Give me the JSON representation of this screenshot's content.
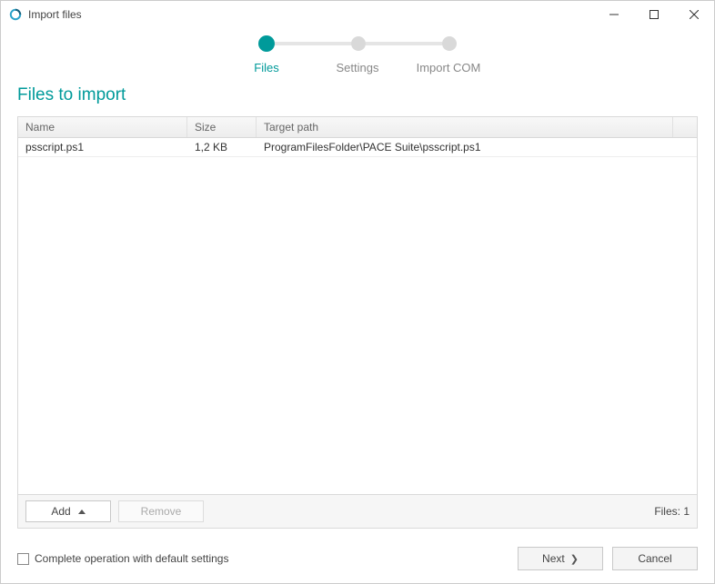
{
  "window": {
    "title": "Import files"
  },
  "stepper": {
    "steps": [
      {
        "label": "Files",
        "active": true
      },
      {
        "label": "Settings",
        "active": false
      },
      {
        "label": "Import COM",
        "active": false
      }
    ]
  },
  "section": {
    "title": "Files to import"
  },
  "table": {
    "columns": {
      "name": "Name",
      "size": "Size",
      "path": "Target path"
    },
    "rows": [
      {
        "name": "psscript.ps1",
        "size": "1,2 KB",
        "path": "ProgramFilesFolder\\PACE Suite\\psscript.ps1"
      }
    ],
    "footer": {
      "add_label": "Add",
      "remove_label": "Remove",
      "count_label": "Files: 1"
    }
  },
  "bottom": {
    "checkbox_label": "Complete operation with default settings",
    "next_label": "Next",
    "cancel_label": "Cancel"
  }
}
